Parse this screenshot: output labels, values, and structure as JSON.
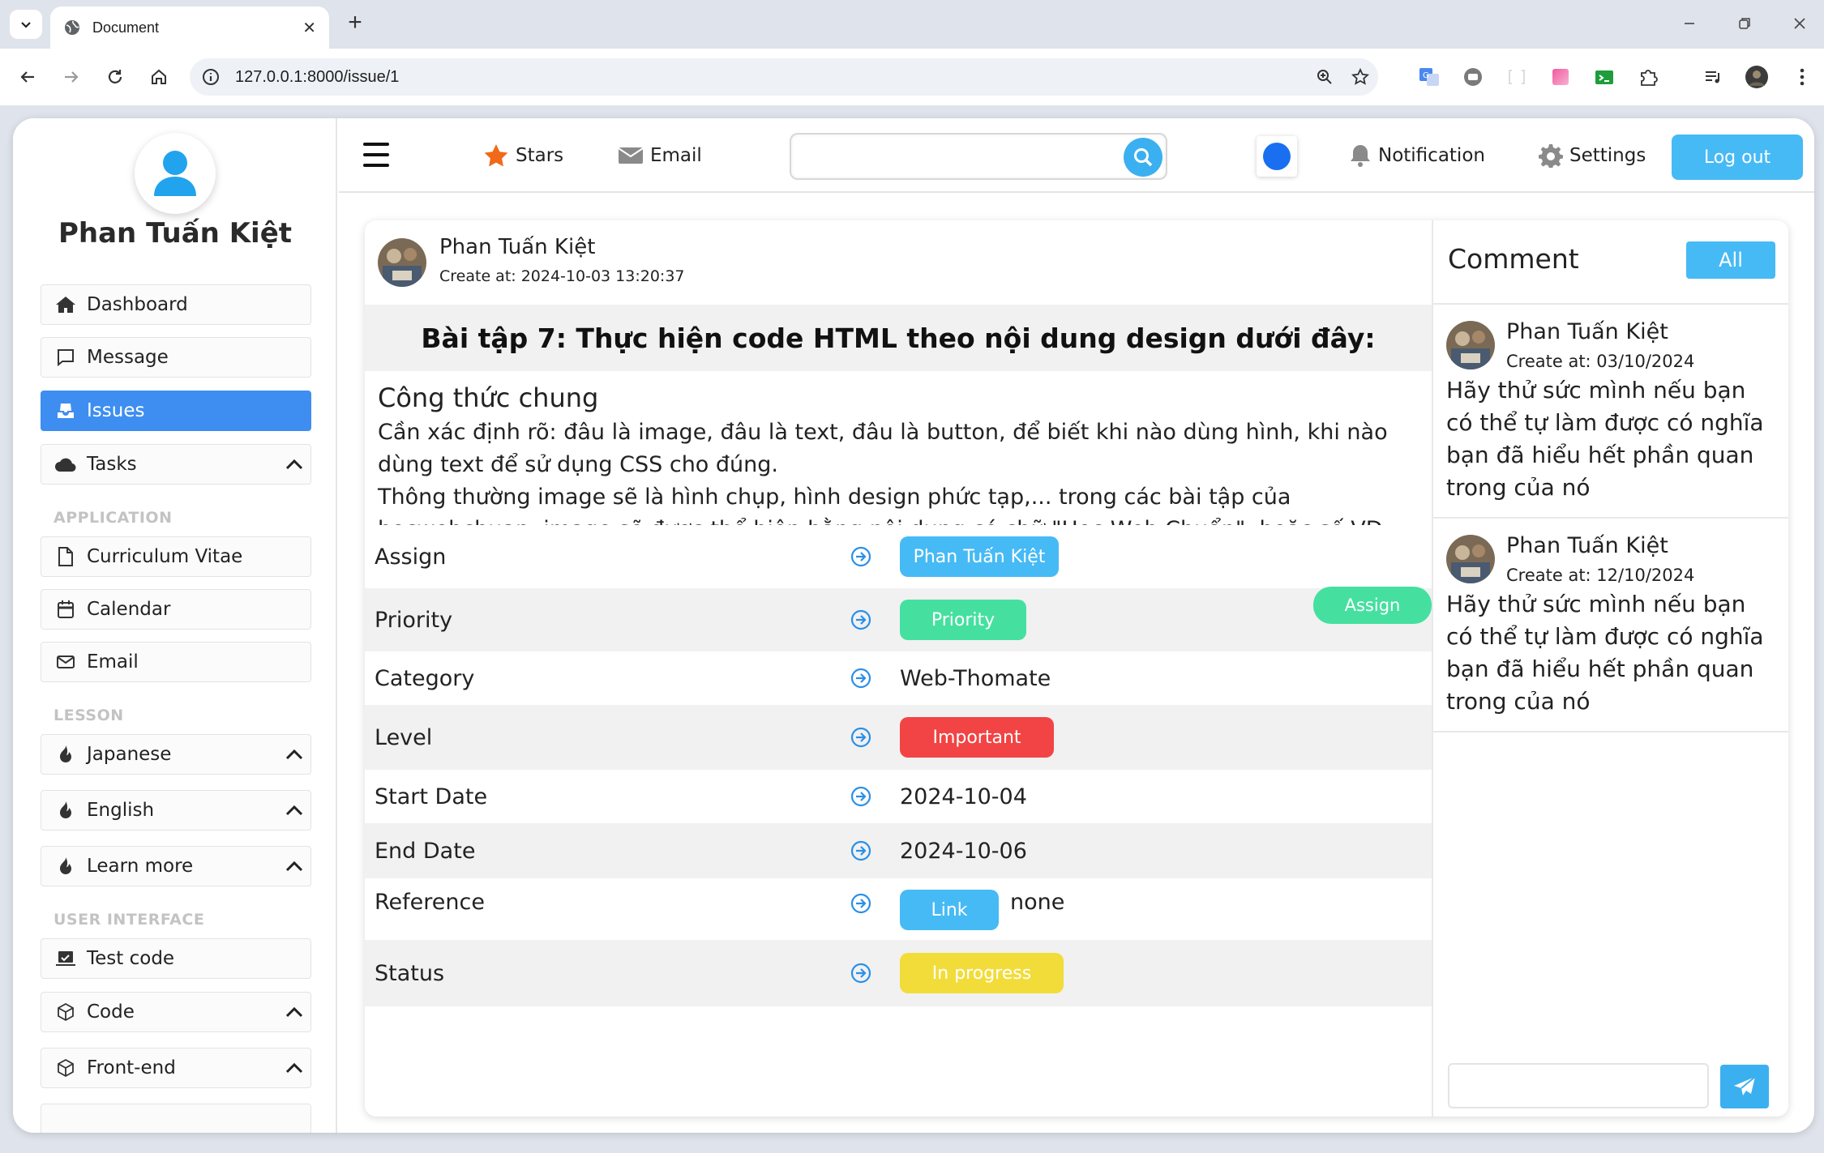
{
  "browser": {
    "tab_title": "Document",
    "url": "127.0.0.1:8000/issue/1"
  },
  "sidebar": {
    "user_name": "Phan Tuấn Kiệt",
    "items": [
      {
        "label": "Dashboard",
        "icon": "home-icon"
      },
      {
        "label": "Message",
        "icon": "message-icon"
      },
      {
        "label": "Issues",
        "icon": "inbox-icon",
        "active": true
      },
      {
        "label": "Tasks",
        "icon": "cloud-icon"
      }
    ],
    "section_application": "APPLICATION",
    "application_items": [
      {
        "label": "Curriculum Vitae",
        "icon": "file-icon"
      },
      {
        "label": "Calendar",
        "icon": "calendar-icon"
      },
      {
        "label": "Email",
        "icon": "envelope-icon"
      }
    ],
    "section_lesson": "LESSON",
    "lesson_items": [
      {
        "label": "Japanese",
        "icon": "fire-icon"
      },
      {
        "label": "English",
        "icon": "fire-icon"
      },
      {
        "label": "Learn more",
        "icon": "fire-icon"
      }
    ],
    "section_ui": "USER INTERFACE",
    "ui_items": [
      {
        "label": "Test code",
        "icon": "laptop-icon"
      },
      {
        "label": "Code",
        "icon": "cube-icon"
      },
      {
        "label": "Front-end",
        "icon": "cube-icon"
      }
    ]
  },
  "topbar": {
    "stars_label": "Stars",
    "email_label": "Email",
    "search_value": "",
    "notification_label": "Notification",
    "settings_label": "Settings",
    "logout_label": "Log out"
  },
  "issue": {
    "author": "Phan Tuấn Kiệt",
    "created": "Create at: 2024-10-03 13:20:37",
    "title": "Bài tập 7: Thực hiện code HTML theo nội dung design dưới đây:",
    "body_heading": "Công thức chung",
    "body_text": "Cần xác định rõ: đâu là image, đâu là text, đâu là button, để biết khi nào dùng hình, khi nào dùng text để sử dụng CSS cho đúng.\nThông thường image sẽ là hình chụp, hình design phức tạp,... trong các bài tập của hocwebchuan, image sẽ được thể hiện bằng nội dung có chữ \"Học Web Chuẩn\", hoặc số VD: \"500x600\".\nMột số bài tập có sử dụng font icon, hocwebchuan sẽ sử dụng bộ font của fontawesome thuận lợi việc code",
    "assign_button": "Assign",
    "details": {
      "assign_label": "Assign",
      "assign_value": "Phan Tuấn Kiệt",
      "priority_label": "Priority",
      "priority_value": "Priority",
      "category_label": "Category",
      "category_value": "Web-Thomate",
      "level_label": "Level",
      "level_value": "Important",
      "start_label": "Start Date",
      "start_value": "2024-10-04",
      "end_label": "End Date",
      "end_value": "2024-10-06",
      "reference_label": "Reference",
      "reference_link": "Link",
      "reference_value": "none",
      "status_label": "Status",
      "status_value": "In progress"
    }
  },
  "comments": {
    "title": "Comment",
    "all_button": "All",
    "items": [
      {
        "name": "Phan Tuấn Kiệt",
        "date": "Create at: 03/10/2024",
        "text": "Hãy thử sức mình nếu bạn có thể tự làm được có nghĩa bạn đã hiểu hết phần quan trong của nó"
      },
      {
        "name": "Phan Tuấn Kiệt",
        "date": "Create at: 12/10/2024",
        "text": "Hãy thử sức mình nếu bạn có thể tự làm được có nghĩa bạn đã hiểu hết phần quan trong của nó"
      }
    ],
    "input_value": ""
  },
  "colors": {
    "primary": "#3d8ef0",
    "accent_blue": "#46baf5",
    "green": "#45e0a0",
    "red": "#f24444",
    "yellow": "#f2dc3a"
  }
}
